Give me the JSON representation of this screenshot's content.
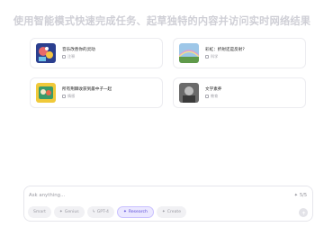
{
  "headline": "使用智能模式快速完成任务、起草独特的内容并访问实时网络结果",
  "cards": [
    {
      "title": "音乐改善你的灵动",
      "meta": "注释"
    },
    {
      "title": "彩虹：折射还是反射?",
      "meta": "科学"
    },
    {
      "title": "所有荆棘收获到最中子一起",
      "meta": "情感"
    },
    {
      "title": "文学素养",
      "meta": "教育"
    }
  ],
  "input": {
    "placeholder": "Ask anything...",
    "counter": "5/5"
  },
  "modes": [
    {
      "label": "Smart",
      "icon": ""
    },
    {
      "label": "Genius",
      "icon": "sparkle-icon"
    },
    {
      "label": "GPT-4",
      "icon": "bolt-icon"
    },
    {
      "label": "Research",
      "icon": "sparkle-icon",
      "active": true
    },
    {
      "label": "Create",
      "icon": "sparkle-icon"
    }
  ],
  "colors": {
    "accent": "#5a4bd8",
    "accent_bg": "#ebe8ff"
  }
}
